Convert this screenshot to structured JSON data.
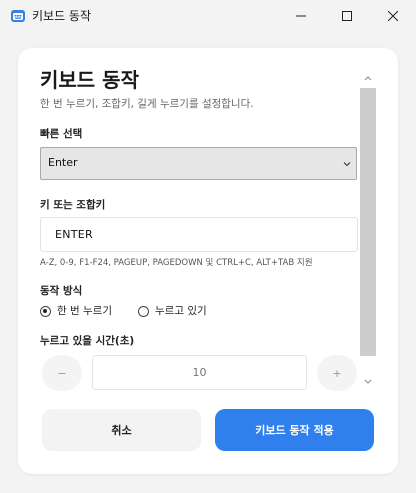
{
  "window": {
    "title": "키보드 동작",
    "icon": "app-icon"
  },
  "dialog": {
    "title": "키보드 동작",
    "subtitle": "한 번 누르기, 조합키, 길게 누르기를 설정합니다."
  },
  "quick_select": {
    "label": "빠른 선택",
    "value": "Enter"
  },
  "key_input": {
    "label": "키 또는 조합키",
    "value": "ENTER",
    "hint": "A-Z, 0-9, F1-F24, PAGEUP, PAGEDOWN 및 CTRL+C, ALT+TAB 지원"
  },
  "action_mode": {
    "label": "동작 방식",
    "options": [
      {
        "label": "한 번 누르기",
        "checked": true
      },
      {
        "label": "누르고 있기",
        "checked": false
      }
    ]
  },
  "hold_time": {
    "label": "누르고 있을 시간(초)",
    "value": "10",
    "minus": "−",
    "plus": "+"
  },
  "buttons": {
    "cancel": "취소",
    "apply": "키보드 동작 적용"
  },
  "colors": {
    "accent": "#2f80ed",
    "background": "#f3f3f3",
    "card": "#ffffff"
  }
}
